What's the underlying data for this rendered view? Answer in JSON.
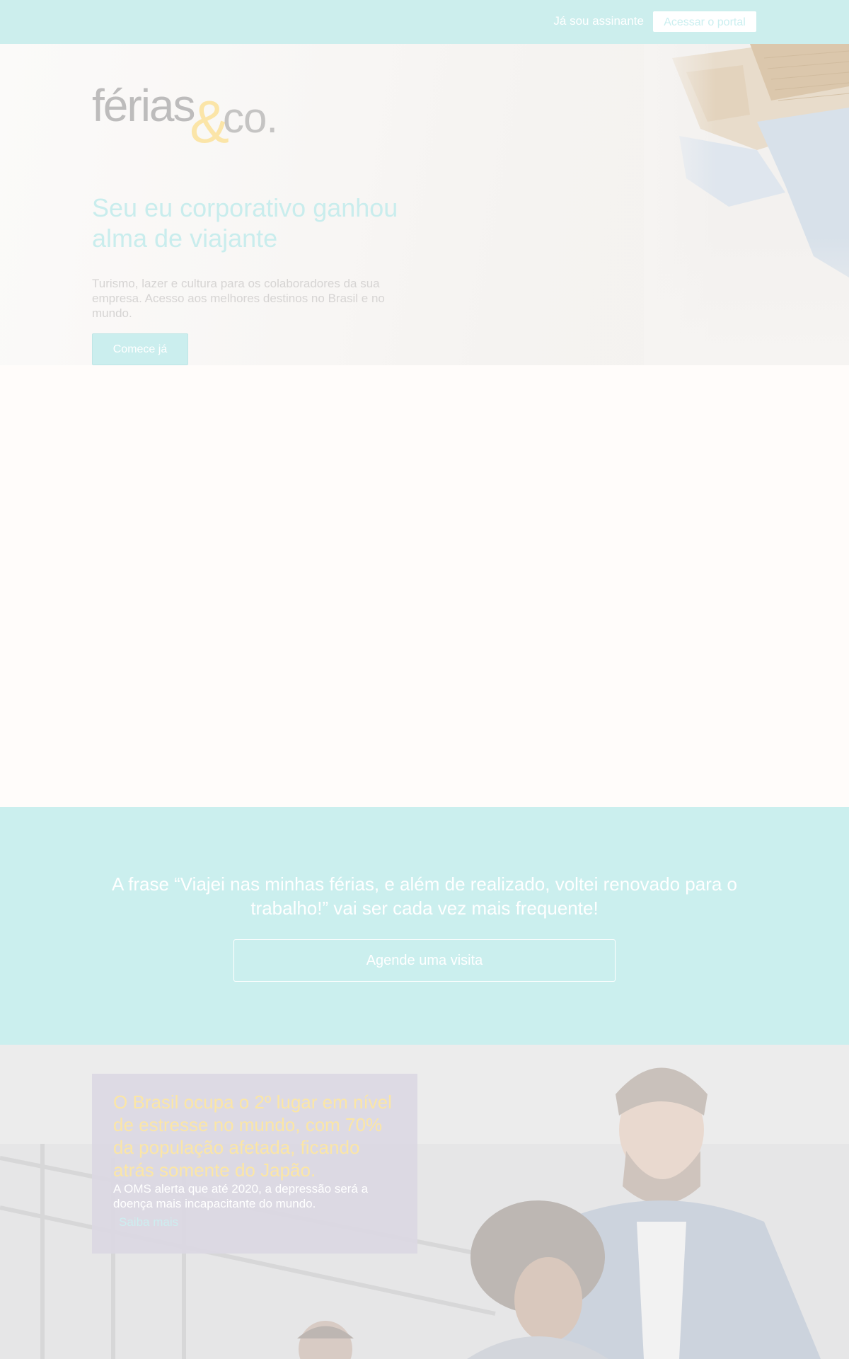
{
  "topbar": {
    "subscriber_text": "Já sou assinante",
    "portal_button": "Acessar o portal"
  },
  "logo": {
    "part1": "férias",
    "ampersand": "&",
    "part2": "co."
  },
  "hero": {
    "title": "Seu eu corporativo ganhou alma de viajante",
    "description": "Turismo, lazer e cultura para os colaboradores da sua empresa. Acesso aos melhores destinos no Brasil e no mundo.",
    "cta": "Comece já"
  },
  "quote": {
    "text": "A frase “Viajei nas minhas férias, e além de realizado, voltei renovado para o trabalho!” vai ser cada vez mais frequente!",
    "button": "Agende uma visita"
  },
  "stats": {
    "title": "O Brasil ocupa o 2º lugar em nível de estresse no mundo, com 70% da população afetada, ficando atrás somente do Japão.",
    "description": "A OMS alerta que até 2020, a depressão será a doença mais incapacitante do mundo.",
    "link": "Saiba mais"
  },
  "colors": {
    "topbar": "#cceeed",
    "accent_teal": "#cbeeee",
    "logo_gold": "#fbe5a8",
    "card_purple": "#dbd8e3"
  }
}
